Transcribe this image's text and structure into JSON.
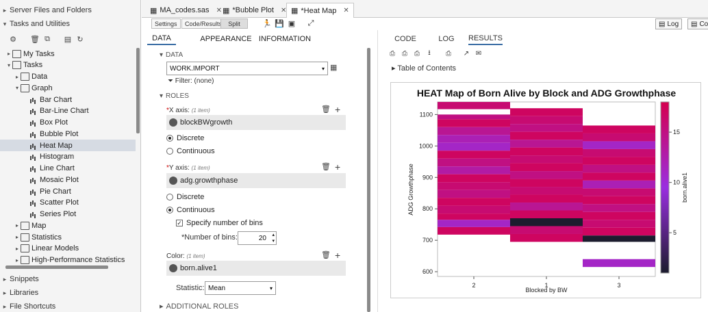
{
  "left_nav": {
    "sections_top": [
      {
        "label": "Server Files and Folders",
        "chev": "▸"
      },
      {
        "label": "Tasks and Utilities",
        "chev": "▾"
      }
    ],
    "tree": [
      {
        "label": "My Tasks",
        "depth": 1,
        "tw": "▸",
        "icon": "folder"
      },
      {
        "label": "Tasks",
        "depth": 1,
        "tw": "▾",
        "icon": "folder"
      },
      {
        "label": "Data",
        "depth": 2,
        "tw": "▸",
        "icon": "folder"
      },
      {
        "label": "Graph",
        "depth": 2,
        "tw": "▾",
        "icon": "folder"
      },
      {
        "label": "Bar Chart",
        "depth": 3,
        "tw": "",
        "icon": "chart"
      },
      {
        "label": "Bar-Line Chart",
        "depth": 3,
        "tw": "",
        "icon": "chart"
      },
      {
        "label": "Box Plot",
        "depth": 3,
        "tw": "",
        "icon": "chart"
      },
      {
        "label": "Bubble Plot",
        "depth": 3,
        "tw": "",
        "icon": "chart"
      },
      {
        "label": "Heat Map",
        "depth": 3,
        "tw": "",
        "icon": "chart",
        "selected": true
      },
      {
        "label": "Histogram",
        "depth": 3,
        "tw": "",
        "icon": "chart"
      },
      {
        "label": "Line Chart",
        "depth": 3,
        "tw": "",
        "icon": "chart"
      },
      {
        "label": "Mosaic Plot",
        "depth": 3,
        "tw": "",
        "icon": "chart"
      },
      {
        "label": "Pie Chart",
        "depth": 3,
        "tw": "",
        "icon": "chart"
      },
      {
        "label": "Scatter Plot",
        "depth": 3,
        "tw": "",
        "icon": "chart"
      },
      {
        "label": "Series Plot",
        "depth": 3,
        "tw": "",
        "icon": "chart"
      },
      {
        "label": "Map",
        "depth": 2,
        "tw": "▸",
        "icon": "folder"
      },
      {
        "label": "Statistics",
        "depth": 2,
        "tw": "▸",
        "icon": "folder"
      },
      {
        "label": "Linear Models",
        "depth": 2,
        "tw": "▸",
        "icon": "folder"
      },
      {
        "label": "High-Performance Statistics",
        "depth": 2,
        "tw": "▸",
        "icon": "folder"
      }
    ],
    "sections_bottom": [
      {
        "label": "Snippets",
        "chev": "▸"
      },
      {
        "label": "Libraries",
        "chev": "▸"
      },
      {
        "label": "File Shortcuts",
        "chev": "▸"
      }
    ]
  },
  "doc_tabs": [
    {
      "label": "MA_codes.sas",
      "close": "✕"
    },
    {
      "label": "*Bubble Plot",
      "close": "✕"
    },
    {
      "label": "*Heat Map",
      "close": "✕",
      "active": true
    }
  ],
  "toolbar": {
    "settings": "Settings",
    "code_results": "Code/Results",
    "split": "Split"
  },
  "task": {
    "tabs": [
      "DATA",
      "APPEARANCE",
      "INFORMATION"
    ],
    "data_header": "DATA",
    "dataset": "WORK.IMPORT",
    "filter": "Filter: (none)",
    "roles_header": "ROLES",
    "xaxis_label": "X axis:",
    "xaxis_hint": "(1 item)",
    "xaxis_var": "blockBWgrowth",
    "discrete": "Discrete",
    "continuous": "Continuous",
    "yaxis_label": "Y axis:",
    "yaxis_hint": "(1 item)",
    "yaxis_var": "adg.growthphase",
    "specify_bins": "Specify number of bins",
    "num_bins_label": "*Number of bins:",
    "num_bins_value": "20",
    "color_label": "Color:",
    "color_hint": "(1 item)",
    "color_var": "born.alive1",
    "statistic_label": "Statistic:",
    "statistic_value": "Mean",
    "additional_roles": "ADDITIONAL ROLES",
    "req_mark": "*"
  },
  "results": {
    "tabs": [
      "CODE",
      "LOG",
      "RESULTS"
    ],
    "toc": "Table of Contents",
    "log_btn": "Log",
    "code_btn": "Cod"
  },
  "chart_data": {
    "type": "heatmap",
    "title": "HEAT Map of Born Alive by Block and ADG Growthphase",
    "xlabel": "Blocked by BW",
    "ylabel": "ADG Growthphase",
    "categories": [
      "2",
      "1",
      "3"
    ],
    "yticks": [
      600,
      700,
      800,
      900,
      1000,
      1100
    ],
    "ylim": [
      585,
      1140
    ],
    "colorbar_label": "born.alive1",
    "colorbar_ticks": [
      5,
      10,
      15
    ],
    "colorbar_range": [
      1,
      18
    ],
    "colors": {
      "low": "#1c1c2e",
      "mid": "#9a2ee0",
      "high": "#d5004f"
    },
    "bins": [
      {
        "x": "2",
        "y0": 1117,
        "y1": 1140,
        "v": 16
      },
      {
        "x": "2",
        "y0": 1085,
        "y1": 1100,
        "v": 15
      },
      {
        "x": "2",
        "y0": 1060,
        "y1": 1085,
        "v": 17
      },
      {
        "x": "2",
        "y0": 1035,
        "y1": 1060,
        "v": 14
      },
      {
        "x": "2",
        "y0": 1010,
        "y1": 1035,
        "v": 12
      },
      {
        "x": "2",
        "y0": 985,
        "y1": 1010,
        "v": 11
      },
      {
        "x": "2",
        "y0": 960,
        "y1": 985,
        "v": 17
      },
      {
        "x": "2",
        "y0": 935,
        "y1": 960,
        "v": 15
      },
      {
        "x": "2",
        "y0": 910,
        "y1": 935,
        "v": 13
      },
      {
        "x": "2",
        "y0": 885,
        "y1": 910,
        "v": 17
      },
      {
        "x": "2",
        "y0": 860,
        "y1": 885,
        "v": 16
      },
      {
        "x": "2",
        "y0": 835,
        "y1": 860,
        "v": 15
      },
      {
        "x": "2",
        "y0": 810,
        "y1": 835,
        "v": 17
      },
      {
        "x": "2",
        "y0": 785,
        "y1": 810,
        "v": 16
      },
      {
        "x": "2",
        "y0": 765,
        "y1": 785,
        "v": 17
      },
      {
        "x": "2",
        "y0": 742,
        "y1": 765,
        "v": 11
      },
      {
        "x": "2",
        "y0": 718,
        "y1": 742,
        "v": 17
      },
      {
        "x": "1",
        "y0": 1095,
        "y1": 1120,
        "v": 17
      },
      {
        "x": "1",
        "y0": 1070,
        "y1": 1095,
        "v": 16
      },
      {
        "x": "1",
        "y0": 1045,
        "y1": 1070,
        "v": 15
      },
      {
        "x": "1",
        "y0": 1020,
        "y1": 1045,
        "v": 17
      },
      {
        "x": "1",
        "y0": 995,
        "y1": 1020,
        "v": 14
      },
      {
        "x": "1",
        "y0": 970,
        "y1": 995,
        "v": 17
      },
      {
        "x": "1",
        "y0": 945,
        "y1": 970,
        "v": 16
      },
      {
        "x": "1",
        "y0": 920,
        "y1": 945,
        "v": 17
      },
      {
        "x": "1",
        "y0": 895,
        "y1": 920,
        "v": 15
      },
      {
        "x": "1",
        "y0": 870,
        "y1": 895,
        "v": 17
      },
      {
        "x": "1",
        "y0": 845,
        "y1": 870,
        "v": 16
      },
      {
        "x": "1",
        "y0": 820,
        "y1": 845,
        "v": 17
      },
      {
        "x": "1",
        "y0": 795,
        "y1": 820,
        "v": 14
      },
      {
        "x": "1",
        "y0": 770,
        "y1": 795,
        "v": 17
      },
      {
        "x": "1",
        "y0": 745,
        "y1": 770,
        "v": 1
      },
      {
        "x": "1",
        "y0": 720,
        "y1": 745,
        "v": 16
      },
      {
        "x": "1",
        "y0": 695,
        "y1": 720,
        "v": 17
      },
      {
        "x": "3",
        "y0": 1040,
        "y1": 1065,
        "v": 17
      },
      {
        "x": "3",
        "y0": 1015,
        "y1": 1040,
        "v": 16
      },
      {
        "x": "3",
        "y0": 990,
        "y1": 1015,
        "v": 11
      },
      {
        "x": "3",
        "y0": 965,
        "y1": 990,
        "v": 16
      },
      {
        "x": "3",
        "y0": 940,
        "y1": 965,
        "v": 17
      },
      {
        "x": "3",
        "y0": 915,
        "y1": 940,
        "v": 15
      },
      {
        "x": "3",
        "y0": 890,
        "y1": 915,
        "v": 17
      },
      {
        "x": "3",
        "y0": 865,
        "y1": 890,
        "v": 12
      },
      {
        "x": "3",
        "y0": 840,
        "y1": 865,
        "v": 16
      },
      {
        "x": "3",
        "y0": 815,
        "y1": 840,
        "v": 17
      },
      {
        "x": "3",
        "y0": 790,
        "y1": 815,
        "v": 15
      },
      {
        "x": "3",
        "y0": 765,
        "y1": 790,
        "v": 17
      },
      {
        "x": "3",
        "y0": 740,
        "y1": 765,
        "v": 16
      },
      {
        "x": "3",
        "y0": 715,
        "y1": 740,
        "v": 17
      },
      {
        "x": "3",
        "y0": 695,
        "y1": 715,
        "v": 1
      },
      {
        "x": "3",
        "y0": 615,
        "y1": 640,
        "v": 11
      }
    ]
  }
}
